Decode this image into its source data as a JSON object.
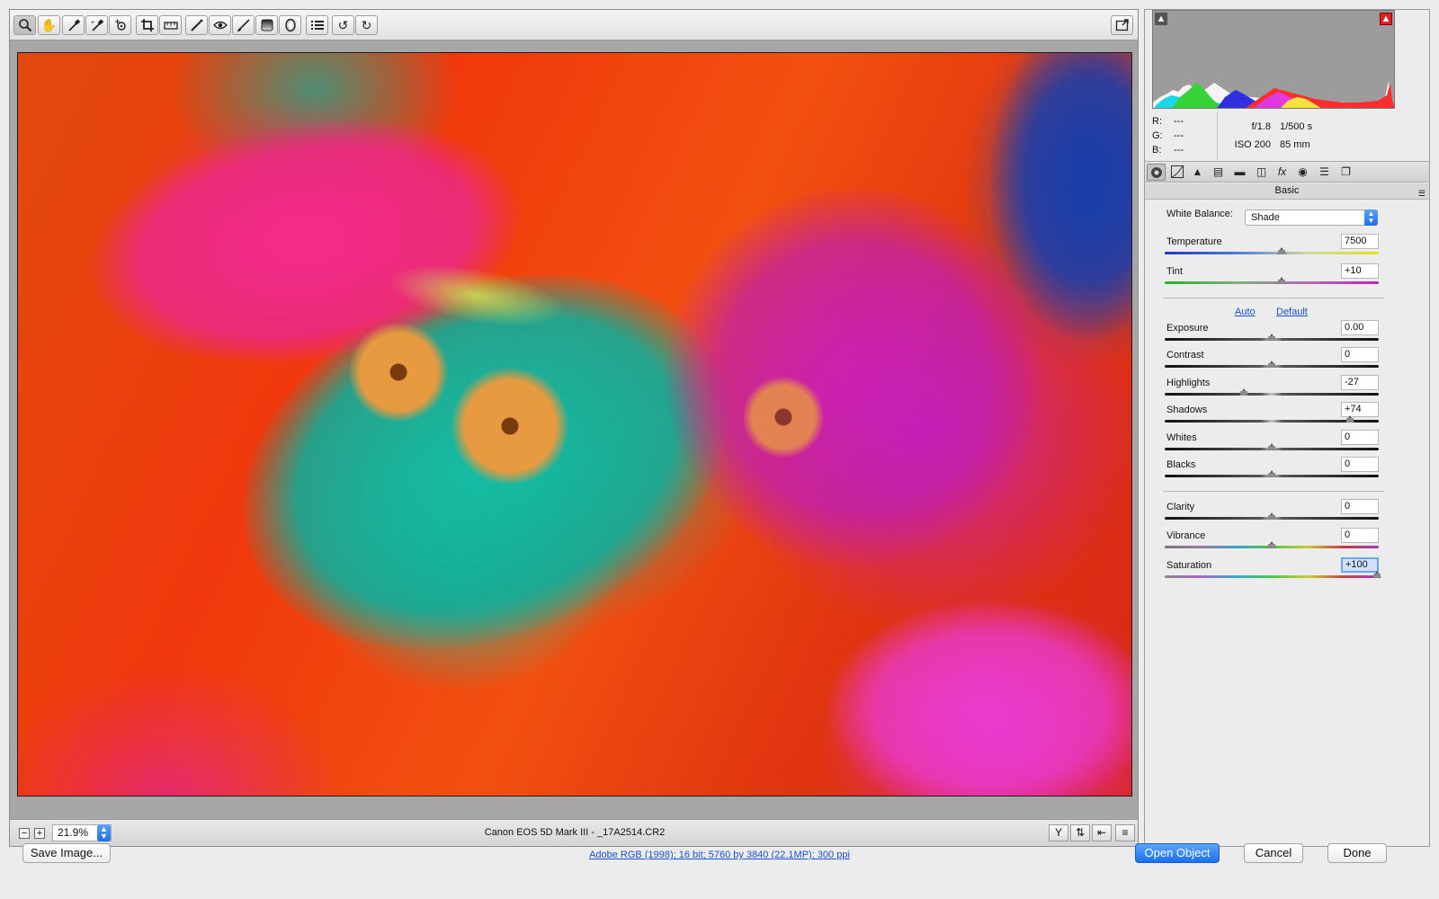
{
  "toolbar": {
    "tools": [
      "zoom-tool",
      "hand-tool",
      "white-balance-tool",
      "color-sampler-tool",
      "targeted-adjustment-tool",
      "crop-tool",
      "straighten-tool",
      "spot-removal-tool",
      "red-eye-tool",
      "adjustment-brush-tool",
      "graduated-filter-tool",
      "radial-filter-tool",
      "preferences-tool",
      "rotate-left-tool",
      "rotate-right-tool"
    ],
    "fullscreen_icon": "fullscreen-toggle-icon"
  },
  "status_bar": {
    "zoom_out": "−",
    "zoom_in": "+",
    "zoom_level": "21.9%",
    "filename": "Canon EOS 5D Mark III  -  _17A2514.CR2"
  },
  "readout": {
    "r_label": "R:",
    "r_value": "---",
    "g_label": "G:",
    "g_value": "---",
    "b_label": "B:",
    "b_value": "---"
  },
  "exif": {
    "aperture": "f/1.8",
    "shutter": "1/500 s",
    "iso": "ISO 200",
    "focal": "85 mm"
  },
  "panel": {
    "title": "Basic",
    "white_balance_label": "White Balance:",
    "white_balance_value": "Shade",
    "auto_label": "Auto",
    "default_label": "Default"
  },
  "sliders": {
    "temperature": {
      "label": "Temperature",
      "value": "7500"
    },
    "tint": {
      "label": "Tint",
      "value": "+10"
    },
    "exposure": {
      "label": "Exposure",
      "value": "0.00"
    },
    "contrast": {
      "label": "Contrast",
      "value": "0"
    },
    "highlights": {
      "label": "Highlights",
      "value": "-27"
    },
    "shadows": {
      "label": "Shadows",
      "value": "+74"
    },
    "whites": {
      "label": "Whites",
      "value": "0"
    },
    "blacks": {
      "label": "Blacks",
      "value": "0"
    },
    "clarity": {
      "label": "Clarity",
      "value": "0"
    },
    "vibrance": {
      "label": "Vibrance",
      "value": "0"
    },
    "saturation": {
      "label": "Saturation",
      "value": "+100"
    }
  },
  "footer": {
    "save_label": "Save Image...",
    "workflow_label": "Adobe RGB (1998); 16 bit; 5760 by 3840 (22.1MP); 300 ppi",
    "open_label": "Open Object",
    "cancel_label": "Cancel",
    "done_label": "Done"
  }
}
